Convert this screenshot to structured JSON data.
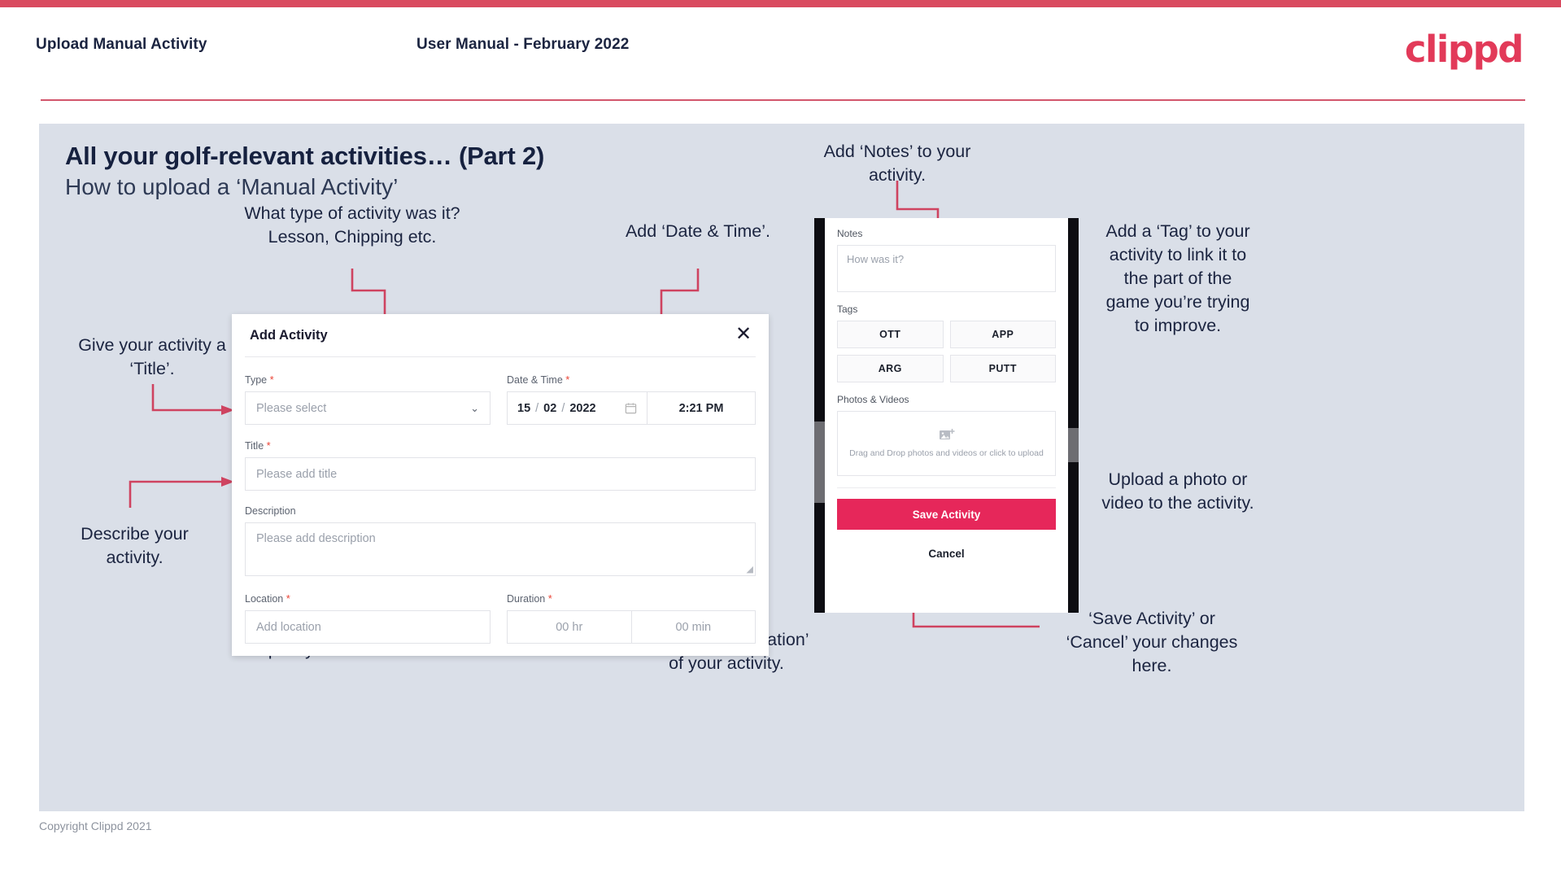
{
  "header": {
    "left_title": "Upload Manual Activity",
    "center_title": "User Manual - February 2022",
    "logo": "clippd"
  },
  "slide": {
    "title_main": "All your golf-relevant activities… (Part 2)",
    "title_sub": "How to upload a ‘Manual Activity’"
  },
  "annotations": {
    "type": "What type of activity was it?\nLesson, Chipping etc.",
    "date_time": "Add ‘Date & Time’.",
    "title": "Give your activity a\n‘Title’.",
    "description": "Describe your\nactivity.",
    "location": "Specify the ‘Location’.",
    "duration": "Specify the ‘Duration’\nof your activity.",
    "notes": "Add ‘Notes’ to your\nactivity.",
    "tags": "Add a ‘Tag’ to your\nactivity to link it to\nthe part of the\ngame you’re trying\nto improve.",
    "upload": "Upload a photo or\nvideo to the activity.",
    "save_cancel": "‘Save Activity’ or\n‘Cancel’ your changes\nhere."
  },
  "dialog": {
    "title": "Add Activity",
    "close_icon": "close-icon",
    "fields": {
      "type": {
        "label": "Type",
        "required": "*",
        "placeholder": "Please select",
        "caret_icon": "chevron-down-icon"
      },
      "date_time": {
        "label": "Date & Time",
        "required": "*",
        "day": "15",
        "month": "02",
        "year": "2022",
        "sep": "/",
        "calendar_icon": "calendar-icon",
        "time": "2:21 PM"
      },
      "title": {
        "label": "Title",
        "required": "*",
        "placeholder": "Please add title"
      },
      "description": {
        "label": "Description",
        "required": "",
        "placeholder": "Please add description"
      },
      "location": {
        "label": "Location",
        "required": "*",
        "placeholder": "Add location"
      },
      "duration": {
        "label": "Duration",
        "required": "*",
        "hours_placeholder": "00 hr",
        "minutes_placeholder": "00 min"
      }
    }
  },
  "phone": {
    "notes_label": "Notes",
    "notes_placeholder": "How was it?",
    "tags_label": "Tags",
    "tags": [
      "OTT",
      "APP",
      "ARG",
      "PUTT"
    ],
    "photos_label": "Photos & Videos",
    "dropzone_icon": "add-image-icon",
    "dropzone_text": "Drag and Drop photos and videos or click to upload",
    "save_label": "Save Activity",
    "cancel_label": "Cancel"
  },
  "footer": {
    "copyright": "Copyright Clippd 2021"
  },
  "colors": {
    "accent_pink": "#e6275a",
    "header_bar": "#d94a5f",
    "slide_bg": "#dadfe8",
    "arrow": "#cf4360",
    "text_dark": "#1b2440"
  }
}
